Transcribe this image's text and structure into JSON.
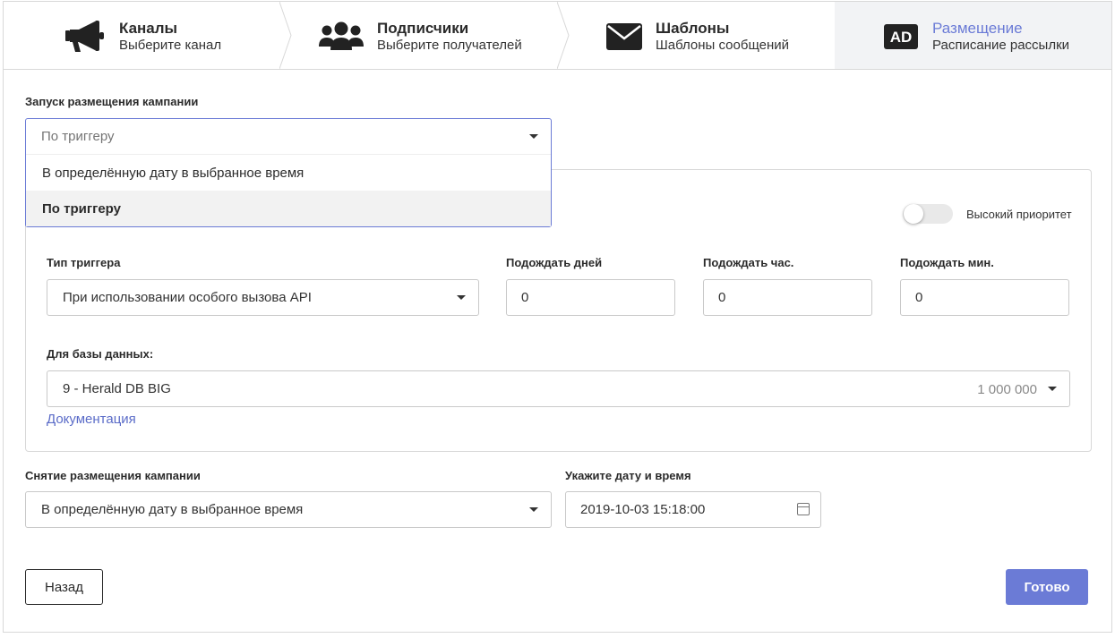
{
  "steps": [
    {
      "title": "Каналы",
      "subtitle": "Выберите канал",
      "icon": "megaphone-icon"
    },
    {
      "title": "Подписчики",
      "subtitle": "Выберите получателей",
      "icon": "users-icon"
    },
    {
      "title": "Шаблоны",
      "subtitle": "Шаблоны сообщений",
      "icon": "envelope-icon"
    },
    {
      "title": "Размещение",
      "subtitle": "Расписание рассылки",
      "icon": "ad-icon",
      "icon_text": "AD"
    }
  ],
  "launch": {
    "label": "Запуск размещения кампании",
    "selected": "По триггеру",
    "options": [
      "В определённую дату в выбранное время",
      "По триггеру"
    ]
  },
  "priority": {
    "label": "Высокий приоритет",
    "enabled": false
  },
  "trigger": {
    "type_label": "Тип триггера",
    "type_value": "При использовании особого вызова API",
    "days_label": "Подождать дней",
    "days_value": "0",
    "hours_label": "Подождать час.",
    "hours_value": "0",
    "minutes_label": "Подождать мин.",
    "minutes_value": "0"
  },
  "database": {
    "label": "Для базы данных:",
    "value": "9 - Herald DB BIG",
    "count": "1 000 000",
    "doc_link": "Документация"
  },
  "removal": {
    "label": "Снятие размещения кампании",
    "value": "В определённую дату в выбранное время",
    "date_label": "Укажите дату и время",
    "date_value": "2019-10-03 15:18:00"
  },
  "buttons": {
    "back": "Назад",
    "done": "Готово"
  },
  "colors": {
    "accent": "#6b7bd6",
    "active_step_bg": "#f2f3f5",
    "border": "#d8d8d8"
  }
}
